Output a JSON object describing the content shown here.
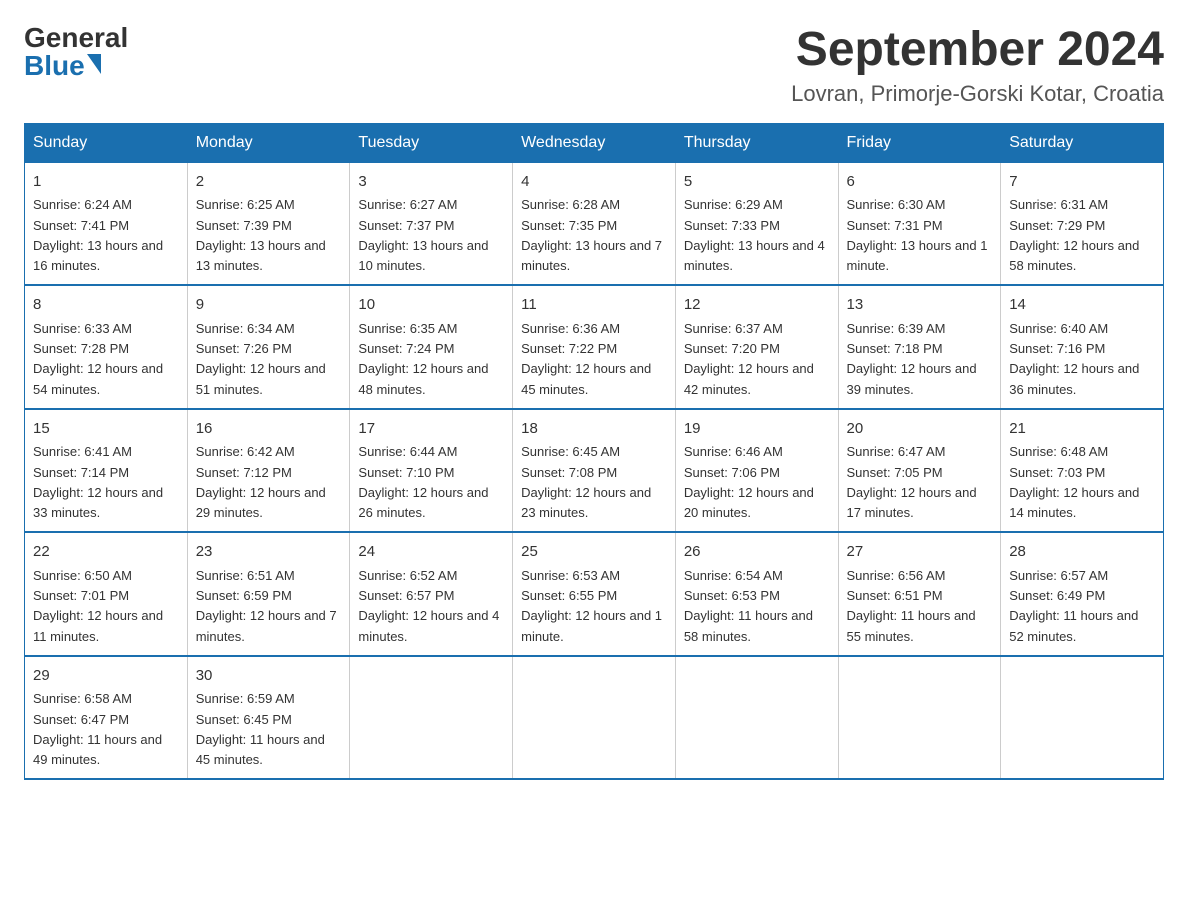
{
  "logo": {
    "general": "General",
    "blue": "Blue"
  },
  "page_title": "September 2024",
  "subtitle": "Lovran, Primorje-Gorski Kotar, Croatia",
  "days_of_week": [
    "Sunday",
    "Monday",
    "Tuesday",
    "Wednesday",
    "Thursday",
    "Friday",
    "Saturday"
  ],
  "weeks": [
    [
      {
        "day": "1",
        "sunrise": "6:24 AM",
        "sunset": "7:41 PM",
        "daylight": "13 hours and 16 minutes."
      },
      {
        "day": "2",
        "sunrise": "6:25 AM",
        "sunset": "7:39 PM",
        "daylight": "13 hours and 13 minutes."
      },
      {
        "day": "3",
        "sunrise": "6:27 AM",
        "sunset": "7:37 PM",
        "daylight": "13 hours and 10 minutes."
      },
      {
        "day": "4",
        "sunrise": "6:28 AM",
        "sunset": "7:35 PM",
        "daylight": "13 hours and 7 minutes."
      },
      {
        "day": "5",
        "sunrise": "6:29 AM",
        "sunset": "7:33 PM",
        "daylight": "13 hours and 4 minutes."
      },
      {
        "day": "6",
        "sunrise": "6:30 AM",
        "sunset": "7:31 PM",
        "daylight": "13 hours and 1 minute."
      },
      {
        "day": "7",
        "sunrise": "6:31 AM",
        "sunset": "7:29 PM",
        "daylight": "12 hours and 58 minutes."
      }
    ],
    [
      {
        "day": "8",
        "sunrise": "6:33 AM",
        "sunset": "7:28 PM",
        "daylight": "12 hours and 54 minutes."
      },
      {
        "day": "9",
        "sunrise": "6:34 AM",
        "sunset": "7:26 PM",
        "daylight": "12 hours and 51 minutes."
      },
      {
        "day": "10",
        "sunrise": "6:35 AM",
        "sunset": "7:24 PM",
        "daylight": "12 hours and 48 minutes."
      },
      {
        "day": "11",
        "sunrise": "6:36 AM",
        "sunset": "7:22 PM",
        "daylight": "12 hours and 45 minutes."
      },
      {
        "day": "12",
        "sunrise": "6:37 AM",
        "sunset": "7:20 PM",
        "daylight": "12 hours and 42 minutes."
      },
      {
        "day": "13",
        "sunrise": "6:39 AM",
        "sunset": "7:18 PM",
        "daylight": "12 hours and 39 minutes."
      },
      {
        "day": "14",
        "sunrise": "6:40 AM",
        "sunset": "7:16 PM",
        "daylight": "12 hours and 36 minutes."
      }
    ],
    [
      {
        "day": "15",
        "sunrise": "6:41 AM",
        "sunset": "7:14 PM",
        "daylight": "12 hours and 33 minutes."
      },
      {
        "day": "16",
        "sunrise": "6:42 AM",
        "sunset": "7:12 PM",
        "daylight": "12 hours and 29 minutes."
      },
      {
        "day": "17",
        "sunrise": "6:44 AM",
        "sunset": "7:10 PM",
        "daylight": "12 hours and 26 minutes."
      },
      {
        "day": "18",
        "sunrise": "6:45 AM",
        "sunset": "7:08 PM",
        "daylight": "12 hours and 23 minutes."
      },
      {
        "day": "19",
        "sunrise": "6:46 AM",
        "sunset": "7:06 PM",
        "daylight": "12 hours and 20 minutes."
      },
      {
        "day": "20",
        "sunrise": "6:47 AM",
        "sunset": "7:05 PM",
        "daylight": "12 hours and 17 minutes."
      },
      {
        "day": "21",
        "sunrise": "6:48 AM",
        "sunset": "7:03 PM",
        "daylight": "12 hours and 14 minutes."
      }
    ],
    [
      {
        "day": "22",
        "sunrise": "6:50 AM",
        "sunset": "7:01 PM",
        "daylight": "12 hours and 11 minutes."
      },
      {
        "day": "23",
        "sunrise": "6:51 AM",
        "sunset": "6:59 PM",
        "daylight": "12 hours and 7 minutes."
      },
      {
        "day": "24",
        "sunrise": "6:52 AM",
        "sunset": "6:57 PM",
        "daylight": "12 hours and 4 minutes."
      },
      {
        "day": "25",
        "sunrise": "6:53 AM",
        "sunset": "6:55 PM",
        "daylight": "12 hours and 1 minute."
      },
      {
        "day": "26",
        "sunrise": "6:54 AM",
        "sunset": "6:53 PM",
        "daylight": "11 hours and 58 minutes."
      },
      {
        "day": "27",
        "sunrise": "6:56 AM",
        "sunset": "6:51 PM",
        "daylight": "11 hours and 55 minutes."
      },
      {
        "day": "28",
        "sunrise": "6:57 AM",
        "sunset": "6:49 PM",
        "daylight": "11 hours and 52 minutes."
      }
    ],
    [
      {
        "day": "29",
        "sunrise": "6:58 AM",
        "sunset": "6:47 PM",
        "daylight": "11 hours and 49 minutes."
      },
      {
        "day": "30",
        "sunrise": "6:59 AM",
        "sunset": "6:45 PM",
        "daylight": "11 hours and 45 minutes."
      },
      null,
      null,
      null,
      null,
      null
    ]
  ],
  "labels": {
    "sunrise": "Sunrise:",
    "sunset": "Sunset:",
    "daylight": "Daylight:"
  }
}
